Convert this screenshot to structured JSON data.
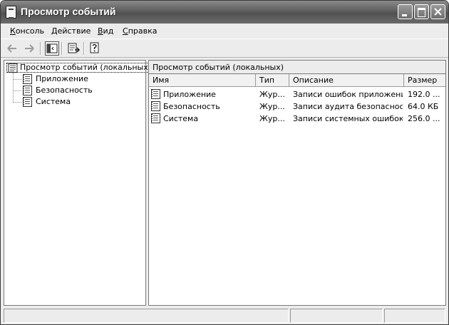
{
  "window": {
    "title": "Просмотр событий",
    "icon": "event-viewer-icon"
  },
  "menu": [
    {
      "label_pre": "",
      "label_ul": "К",
      "label_post": "онсоль"
    },
    {
      "label_pre": "",
      "label_ul": "Д",
      "label_post": "ействие"
    },
    {
      "label_pre": "",
      "label_ul": "В",
      "label_post": "ид"
    },
    {
      "label_pre": "",
      "label_ul": "С",
      "label_post": "правка"
    }
  ],
  "toolbar": {
    "icons": [
      "back-arrow-icon",
      "forward-arrow-icon",
      "show-hide-tree-icon",
      "export-list-icon",
      "help-icon"
    ]
  },
  "tree": {
    "root": "Просмотр событий (локальных)",
    "children": [
      "Приложение",
      "Безопасность",
      "Система"
    ]
  },
  "details": {
    "header": "Просмотр событий (локальных)",
    "columns": [
      "Имя",
      "Тип",
      "Описание",
      "Размер"
    ],
    "rows": [
      {
        "name": "Приложение",
        "type": "Жур...",
        "description": "Записи ошибок приложений",
        "size": "192.0 ..."
      },
      {
        "name": "Безопасность",
        "type": "Жур...",
        "description": "Записи аудита безопасности",
        "size": "64.0 КБ"
      },
      {
        "name": "Система",
        "type": "Жур...",
        "description": "Записи системных ошибок",
        "size": "256.0 ..."
      }
    ]
  }
}
